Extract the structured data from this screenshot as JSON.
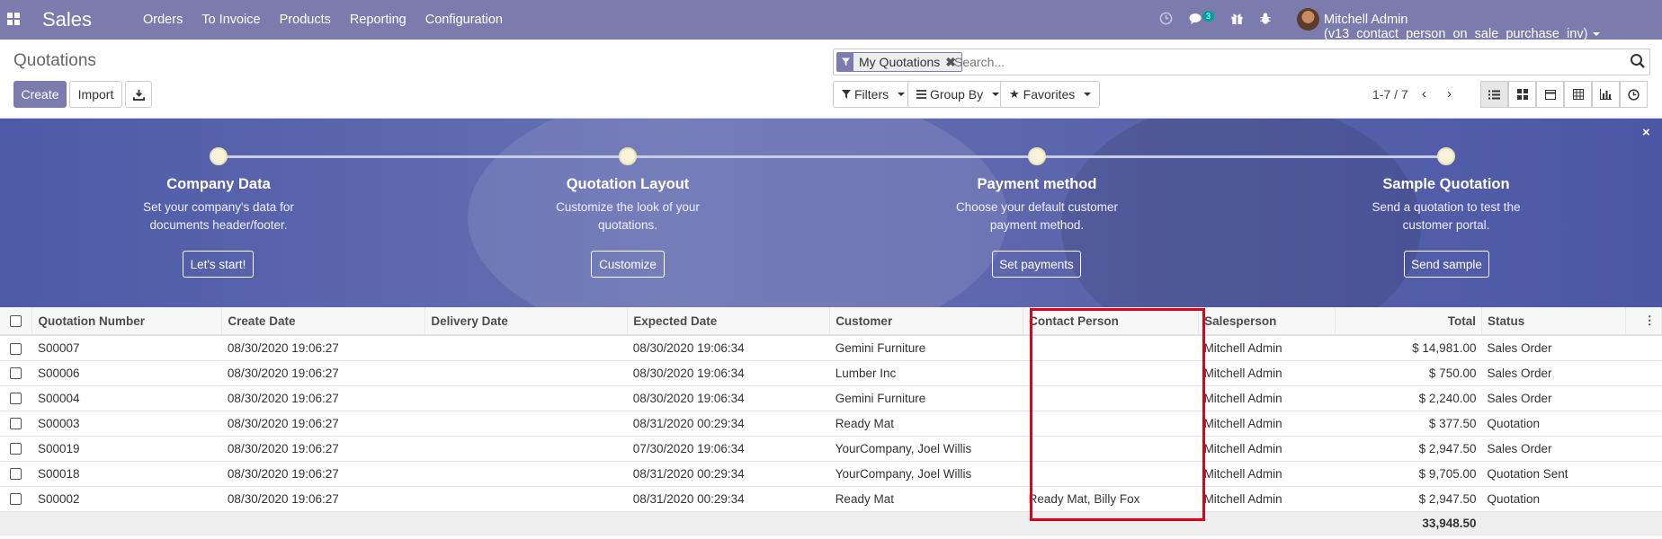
{
  "topbar": {
    "app_name": "Sales",
    "menu": [
      "Orders",
      "To Invoice",
      "Products",
      "Reporting",
      "Configuration"
    ],
    "chat_count": "3",
    "user": "Mitchell Admin (v13_contact_person_on_sale_purchase_inv)",
    "icons": [
      "clock-icon",
      "chat-icon",
      "gift-icon",
      "bug-icon"
    ]
  },
  "control": {
    "breadcrumb": "Quotations",
    "create_label": "Create",
    "import_label": "Import",
    "facet_label": "My Quotations",
    "search_placeholder": "Search...",
    "filters_label": "Filters",
    "groupby_label": "Group By",
    "favorites_label": "Favorites",
    "pager": "1-7 / 7"
  },
  "onboarding": {
    "steps": [
      {
        "title": "Company Data",
        "desc1": "Set your company's data for",
        "desc2": "documents header/footer.",
        "button": "Let's start!"
      },
      {
        "title": "Quotation Layout",
        "desc1": "Customize the look of your",
        "desc2": "quotations.",
        "button": "Customize"
      },
      {
        "title": "Payment method",
        "desc1": "Choose your default customer",
        "desc2": "payment method.",
        "button": "Set payments"
      },
      {
        "title": "Sample Quotation",
        "desc1": "Send a quotation to test the",
        "desc2": "customer portal.",
        "button": "Send sample"
      }
    ],
    "close": "×"
  },
  "table": {
    "headers": {
      "number": "Quotation Number",
      "create": "Create Date",
      "delivery": "Delivery Date",
      "expected": "Expected Date",
      "customer": "Customer",
      "contact": "Contact Person",
      "salesperson": "Salesperson",
      "total": "Total",
      "status": "Status"
    },
    "rows": [
      {
        "number": "S00007",
        "create": "08/30/2020 19:06:27",
        "delivery": "",
        "expected": "08/30/2020 19:06:34",
        "customer": "Gemini Furniture",
        "contact": "",
        "salesperson": "Mitchell Admin",
        "total": "$ 14,981.00",
        "status": "Sales Order"
      },
      {
        "number": "S00006",
        "create": "08/30/2020 19:06:27",
        "delivery": "",
        "expected": "08/30/2020 19:06:34",
        "customer": "Lumber Inc",
        "contact": "",
        "salesperson": "Mitchell Admin",
        "total": "$ 750.00",
        "status": "Sales Order"
      },
      {
        "number": "S00004",
        "create": "08/30/2020 19:06:27",
        "delivery": "",
        "expected": "08/30/2020 19:06:34",
        "customer": "Gemini Furniture",
        "contact": "",
        "salesperson": "Mitchell Admin",
        "total": "$ 2,240.00",
        "status": "Sales Order"
      },
      {
        "number": "S00003",
        "create": "08/30/2020 19:06:27",
        "delivery": "",
        "expected": "08/31/2020 00:29:34",
        "customer": "Ready Mat",
        "contact": "",
        "salesperson": "Mitchell Admin",
        "total": "$ 377.50",
        "status": "Quotation"
      },
      {
        "number": "S00019",
        "create": "08/30/2020 19:06:27",
        "delivery": "",
        "expected": "07/30/2020 19:06:34",
        "customer": "YourCompany, Joel Willis",
        "contact": "",
        "salesperson": "Mitchell Admin",
        "total": "$ 2,947.50",
        "status": "Sales Order"
      },
      {
        "number": "S00018",
        "create": "08/30/2020 19:06:27",
        "delivery": "",
        "expected": "08/31/2020 00:29:34",
        "customer": "YourCompany, Joel Willis",
        "contact": "",
        "salesperson": "Mitchell Admin",
        "total": "$ 9,705.00",
        "status": "Quotation Sent"
      },
      {
        "number": "S00002",
        "create": "08/30/2020 19:06:27",
        "delivery": "",
        "expected": "08/31/2020 00:29:34",
        "customer": "Ready Mat",
        "contact": "Ready Mat, Billy Fox",
        "salesperson": "Mitchell Admin",
        "total": "$ 2,947.50",
        "status": "Quotation"
      }
    ],
    "sum_total": "33,948.50"
  },
  "colors": {
    "brand": "#7c7bad",
    "highlight": "#e0001a"
  }
}
